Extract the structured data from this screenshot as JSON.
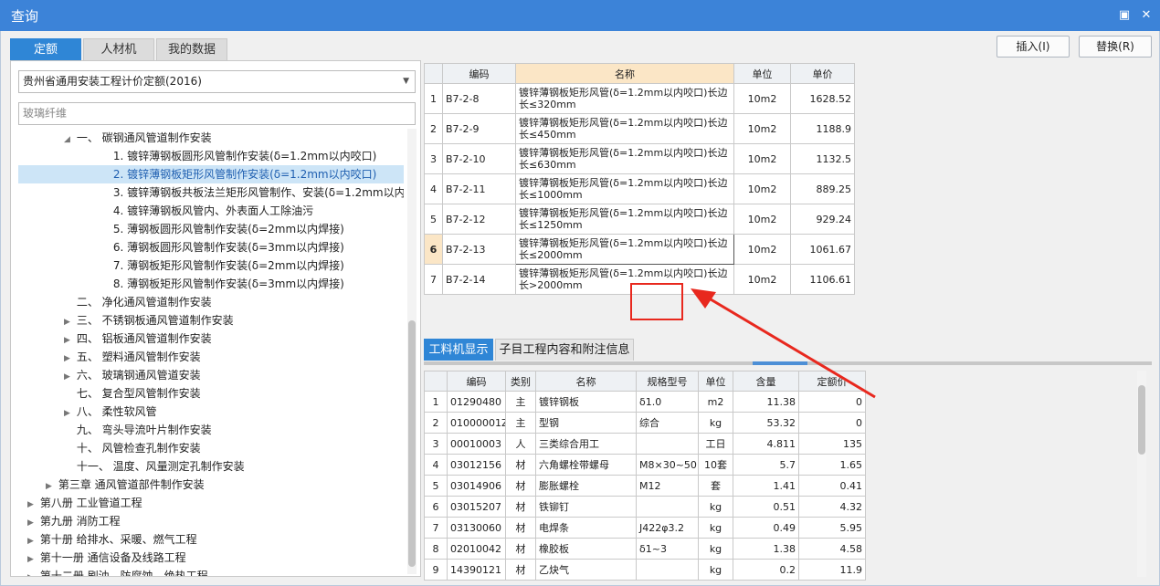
{
  "window": {
    "title": "查询"
  },
  "tabs": [
    "定额",
    "人材机",
    "我的数据"
  ],
  "buttons": {
    "insert": "插入(I)",
    "replace": "替换(R)"
  },
  "left": {
    "combo_value": "贵州省通用安装工程计价定额(2016)",
    "search_value": "玻璃纤维",
    "tree": [
      {
        "label": "一、  碳钢通风管道制作安装",
        "indent": 3,
        "arrow": "down"
      },
      {
        "label": "1.  镀锌薄钢板圆形风管制作安装(δ=1.2mm以内咬口)",
        "indent": 5,
        "arrow": ""
      },
      {
        "label": "2.  镀锌薄钢板矩形风管制作安装(δ=1.2mm以内咬口)",
        "indent": 5,
        "arrow": "",
        "selected": true
      },
      {
        "label": "3.  镀锌薄钢板共板法兰矩形风管制作、安装(δ=1.2mm以内咬…",
        "indent": 5,
        "arrow": ""
      },
      {
        "label": "4.  镀锌薄钢板风管内、外表面人工除油污",
        "indent": 5,
        "arrow": ""
      },
      {
        "label": "5.  薄钢板圆形风管制作安装(δ=2mm以内焊接)",
        "indent": 5,
        "arrow": ""
      },
      {
        "label": "6.  薄钢板圆形风管制作安装(δ=3mm以内焊接)",
        "indent": 5,
        "arrow": ""
      },
      {
        "label": "7.  薄钢板矩形风管制作安装(δ=2mm以内焊接)",
        "indent": 5,
        "arrow": ""
      },
      {
        "label": "8.  薄钢板矩形风管制作安装(δ=3mm以内焊接)",
        "indent": 5,
        "arrow": ""
      },
      {
        "label": "二、  净化通风管道制作安装",
        "indent": 3,
        "arrow": ""
      },
      {
        "label": "三、  不锈钢板通风管道制作安装",
        "indent": 3,
        "arrow": "right"
      },
      {
        "label": "四、  铝板通风管道制作安装",
        "indent": 3,
        "arrow": "right"
      },
      {
        "label": "五、  塑料通风管制作安装",
        "indent": 3,
        "arrow": "right"
      },
      {
        "label": "六、  玻璃钢通风管道安装",
        "indent": 3,
        "arrow": "right"
      },
      {
        "label": "七、  复合型风管制作安装",
        "indent": 3,
        "arrow": ""
      },
      {
        "label": "八、  柔性软风管",
        "indent": 3,
        "arrow": "right"
      },
      {
        "label": "九、  弯头导流叶片制作安装",
        "indent": 3,
        "arrow": ""
      },
      {
        "label": "十、  风管检查孔制作安装",
        "indent": 3,
        "arrow": ""
      },
      {
        "label": "十一、  温度、风量测定孔制作安装",
        "indent": 3,
        "arrow": ""
      },
      {
        "label": "第三章  通风管道部件制作安装",
        "indent": 2,
        "arrow": "right"
      },
      {
        "label": "第八册  工业管道工程",
        "indent": 1,
        "arrow": "right"
      },
      {
        "label": "第九册  消防工程",
        "indent": 1,
        "arrow": "right"
      },
      {
        "label": "第十册  给排水、采暖、燃气工程",
        "indent": 1,
        "arrow": "right"
      },
      {
        "label": "第十一册  通信设备及线路工程",
        "indent": 1,
        "arrow": "right"
      },
      {
        "label": "第十二册  刷油、防腐蚀、绝热工程",
        "indent": 1,
        "arrow": "right"
      }
    ]
  },
  "top_grid": {
    "headers": [
      "",
      "编码",
      "名称",
      "单位",
      "单价"
    ],
    "rows": [
      [
        "1",
        "B7-2-8",
        "镀锌薄钢板矩形风管(δ=1.2mm以内咬口)长边长≤320mm",
        "10m2",
        "1628.52"
      ],
      [
        "2",
        "B7-2-9",
        "镀锌薄钢板矩形风管(δ=1.2mm以内咬口)长边长≤450mm",
        "10m2",
        "1188.9"
      ],
      [
        "3",
        "B7-2-10",
        "镀锌薄钢板矩形风管(δ=1.2mm以内咬口)长边长≤630mm",
        "10m2",
        "1132.5"
      ],
      [
        "4",
        "B7-2-11",
        "镀锌薄钢板矩形风管(δ=1.2mm以内咬口)长边长≤1000mm",
        "10m2",
        "889.25"
      ],
      [
        "5",
        "B7-2-12",
        "镀锌薄钢板矩形风管(δ=1.2mm以内咬口)长边长≤1250mm",
        "10m2",
        "929.24"
      ],
      [
        "6",
        "B7-2-13",
        "镀锌薄钢板矩形风管(δ=1.2mm以内咬口)长边长≤2000mm",
        "10m2",
        "1061.67"
      ],
      [
        "7",
        "B7-2-14",
        "镀锌薄钢板矩形风管(δ=1.2mm以内咬口)长边长>2000mm",
        "10m2",
        "1106.61"
      ]
    ],
    "selected_row": 5
  },
  "bottom_tabs": [
    "工料机显示",
    "子目工程内容和附注信息"
  ],
  "bottom_grid": {
    "headers": [
      "",
      "编码",
      "类别",
      "名称",
      "规格型号",
      "单位",
      "含量",
      "定额价"
    ],
    "rows": [
      [
        "1",
        "01290480",
        "主",
        "镀锌钢板",
        "δ1.0",
        "m2",
        "11.38",
        "0"
      ],
      [
        "2",
        "01000001Z",
        "主",
        "型钢",
        "综合",
        "kg",
        "53.32",
        "0"
      ],
      [
        "3",
        "00010003",
        "人",
        "三类综合用工",
        "",
        "工日",
        "4.811",
        "135"
      ],
      [
        "4",
        "03012156",
        "材",
        "六角螺栓带螺母",
        "M8×30~50",
        "10套",
        "5.7",
        "1.65"
      ],
      [
        "5",
        "03014906",
        "材",
        "膨胀螺栓",
        "M12",
        "套",
        "1.41",
        "0.41"
      ],
      [
        "6",
        "03015207",
        "材",
        "铁铆钉",
        "",
        "kg",
        "0.51",
        "4.32"
      ],
      [
        "7",
        "03130060",
        "材",
        "电焊条",
        "J422φ3.2",
        "kg",
        "0.49",
        "5.95"
      ],
      [
        "8",
        "02010042",
        "材",
        "橡胶板",
        "δ1~3",
        "kg",
        "1.38",
        "4.58"
      ],
      [
        "9",
        "14390121",
        "材",
        "乙炔气",
        "",
        "kg",
        "0.2",
        "11.9"
      ]
    ]
  }
}
